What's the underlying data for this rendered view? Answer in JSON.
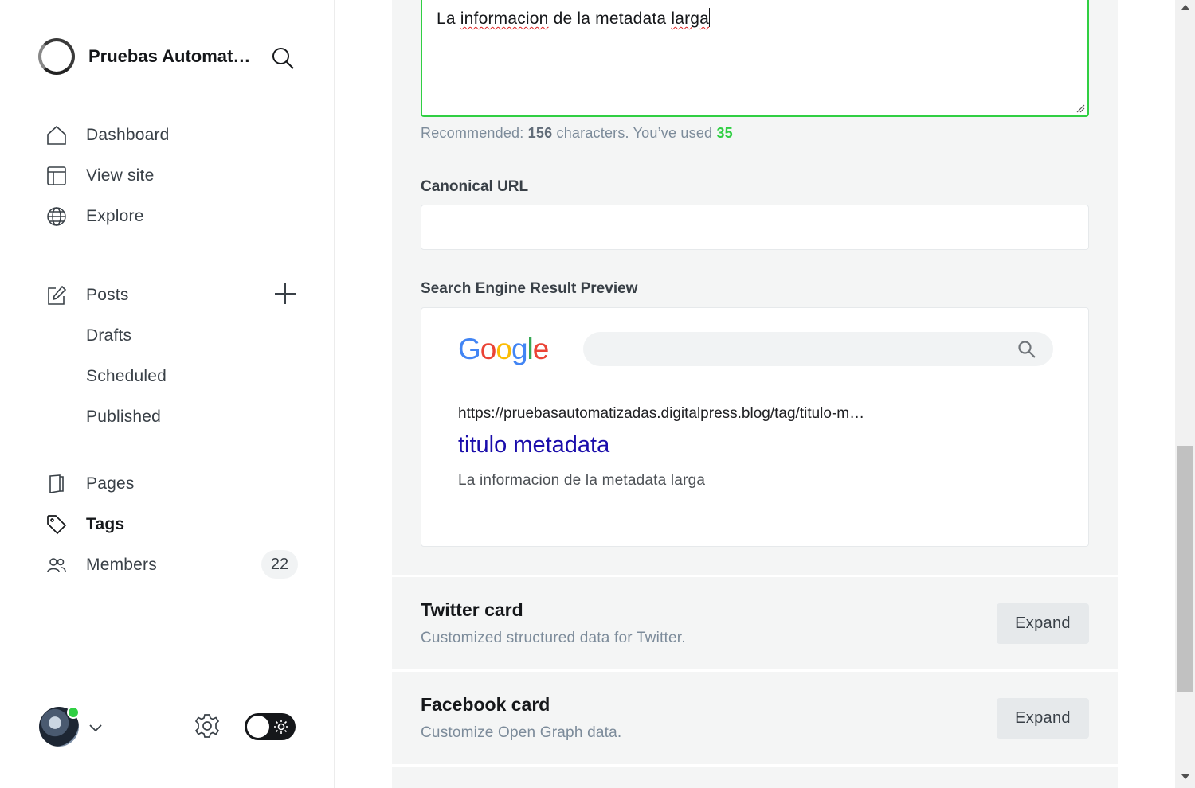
{
  "sidebar": {
    "brand_title": "Pruebas Automatizadas",
    "nav": {
      "dashboard": "Dashboard",
      "view_site": "View site",
      "explore": "Explore",
      "posts": "Posts",
      "drafts": "Drafts",
      "scheduled": "Scheduled",
      "published": "Published",
      "pages": "Pages",
      "tags": "Tags",
      "members": "Members",
      "members_count": "22"
    },
    "active_item": "Tags"
  },
  "meta_description": {
    "value_word1": "La ",
    "value_word2": "informacion",
    "value_word3": " de la metadata ",
    "value_word4": "larga",
    "hint_prefix": "Recommended: ",
    "hint_recommended": "156",
    "hint_middle": " characters. You’ve used ",
    "hint_used": "35"
  },
  "canonical": {
    "label": "Canonical URL",
    "value": ""
  },
  "serp": {
    "label": "Search Engine Result Preview",
    "url": "https://pruebasautomatizadas.digitalpress.blog/tag/titulo-metadata/",
    "title": "titulo metadata",
    "description": "La informacion de la metadata larga"
  },
  "cards": {
    "twitter_title": "Twitter card",
    "twitter_desc": "Customized structured data for Twitter.",
    "facebook_title": "Facebook card",
    "facebook_desc": "Customize Open Graph data.",
    "expand_label": "Expand"
  },
  "colors": {
    "accent_green": "#30cf43",
    "serp_link": "#1a0dab"
  }
}
